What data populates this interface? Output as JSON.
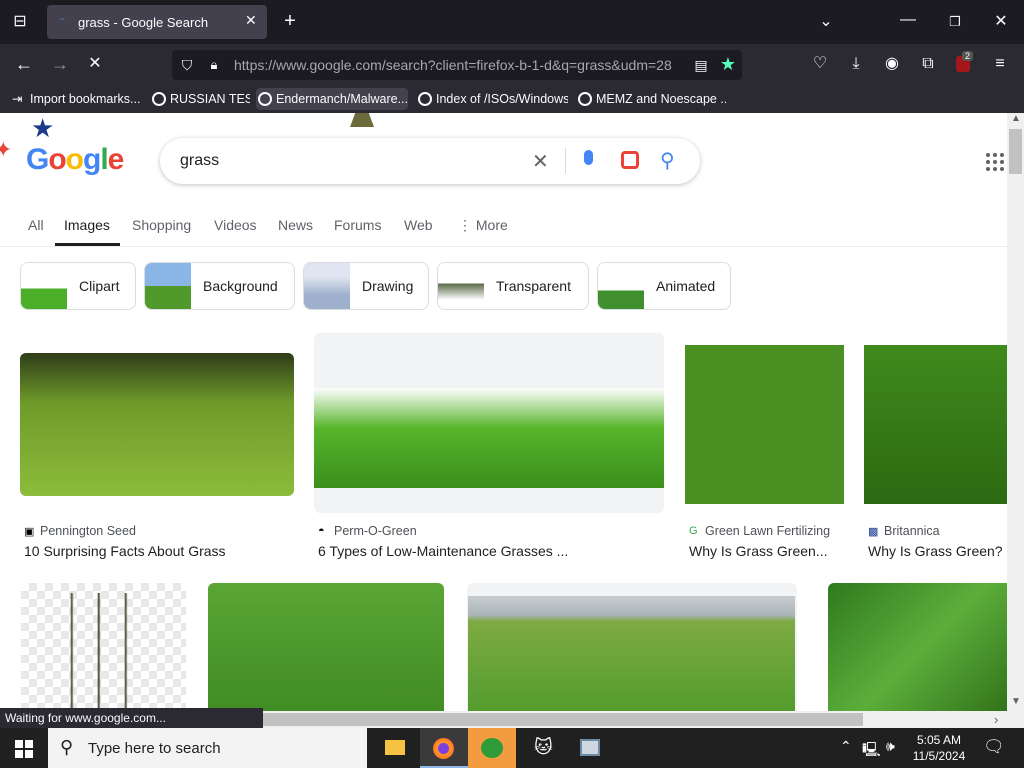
{
  "browser": {
    "tab_title": "grass - Google Search",
    "new_tab_symbol": "+",
    "url": "https://www.google.com/search?client=firefox-b-1-d&q=grass&udm=28",
    "extension_badge": "2",
    "bookmarks": [
      "Import bookmarks...",
      "RUSSIAN TEST",
      "Endermanch/Malware...",
      "Index of /ISOs/Windows",
      "MEMZ and Noescape ..."
    ],
    "status_text": "Waiting for www.google.com..."
  },
  "google": {
    "logo": "Google",
    "query": "grass",
    "tabs": [
      "All",
      "Images",
      "Shopping",
      "Videos",
      "News",
      "Forums",
      "Web",
      "⋮ More"
    ],
    "active_tab": "Images",
    "chips": [
      "Clipart",
      "Background",
      "Drawing",
      "Transparent",
      "Animated"
    ],
    "results": [
      {
        "source": "Pennington Seed",
        "title": "10 Surprising Facts About Grass"
      },
      {
        "source": "Perm-O-Green",
        "title": "6 Types of Low-Maintenance Grasses ..."
      },
      {
        "source": "Green Lawn Fertilizing",
        "title": "Why Is Grass Green..."
      },
      {
        "source": "Britannica",
        "title": "Why Is Grass Green?"
      }
    ]
  },
  "taskbar": {
    "search_placeholder": "Type here to search",
    "time": "5:05 AM",
    "date": "11/5/2024"
  },
  "colors": {
    "accent_blue": "#4285f4",
    "firefox_dark": "#1c1b22",
    "grass": "#4a8f22"
  },
  "icons": [
    "windows-start-icon",
    "search-icon",
    "file-explorer-icon",
    "firefox-icon",
    "app-frog-icon",
    "app-cat-icon",
    "app-window-icon",
    "chevron-up-icon",
    "network-icon",
    "volume-icon",
    "notification-icon"
  ]
}
